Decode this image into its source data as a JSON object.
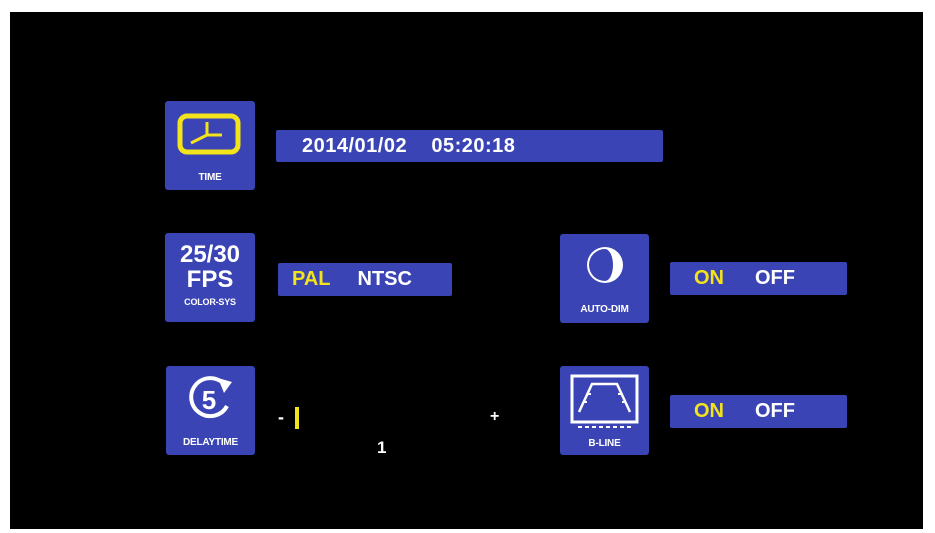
{
  "colors": {
    "background": "#000000",
    "tile": "#3a44b4",
    "accent_yellow": "#f2e31a",
    "text": "#ffffff"
  },
  "time": {
    "icon": "clock-icon",
    "caption": "TIME",
    "value": "2014/01/02    05:20:18"
  },
  "color_sys": {
    "line1": "25/30",
    "line2": "FPS",
    "caption": "COLOR-SYS",
    "options": [
      "PAL",
      "NTSC"
    ],
    "selected": "PAL"
  },
  "auto_dim": {
    "icon": "half-moon-icon",
    "caption": "AUTO-DIM",
    "options": [
      "ON",
      "OFF"
    ],
    "selected": "ON"
  },
  "delay_time": {
    "icon": "delay-5-icon",
    "caption": "DELAYTIME",
    "minus": "-",
    "plus": "+",
    "value": "1",
    "level": 1
  },
  "b_line": {
    "icon": "parking-guide-line-icon",
    "caption": "B-LINE",
    "options": [
      "ON",
      "OFF"
    ],
    "selected": "ON"
  }
}
